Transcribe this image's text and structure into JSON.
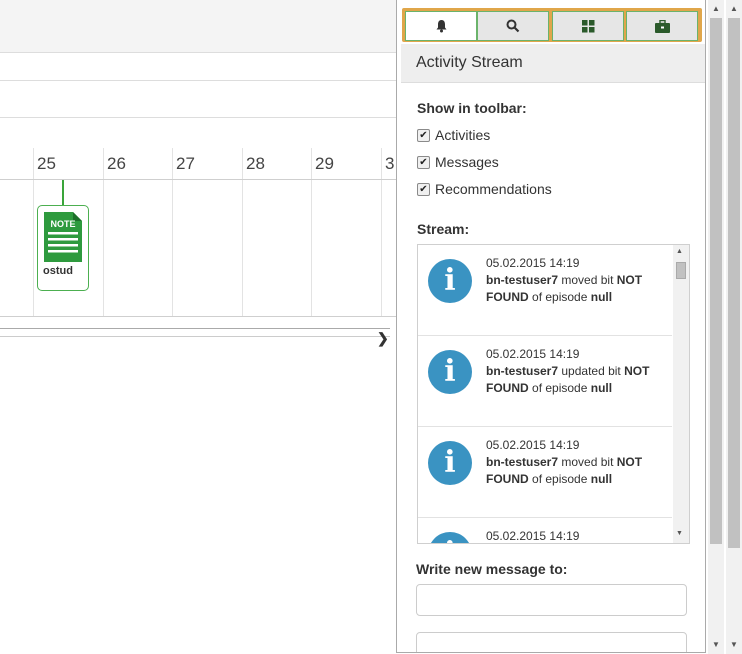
{
  "timeline": {
    "days": [
      "25",
      "26",
      "27",
      "28",
      "29",
      "3"
    ],
    "note": {
      "badge": "NOTE",
      "label": "ostud"
    }
  },
  "panel": {
    "tabs": [
      {
        "icon": "bell-icon",
        "active": true
      },
      {
        "icon": "search-icon",
        "active": false
      },
      {
        "icon": "grid-icon",
        "active": false
      },
      {
        "icon": "briefcase-icon",
        "active": false
      }
    ],
    "title": "Activity Stream",
    "toolbar_label": "Show in toolbar:",
    "checkboxes": [
      {
        "label": "Activities",
        "checked": true
      },
      {
        "label": "Messages",
        "checked": true
      },
      {
        "label": "Recommendations",
        "checked": true
      }
    ],
    "stream_label": "Stream:",
    "stream": [
      {
        "time": "05.02.2015 14:19",
        "user": "bn-testuser7",
        "action": "moved bit",
        "target": "NOT FOUND",
        "middle": "of episode",
        "episode": "null"
      },
      {
        "time": "05.02.2015 14:19",
        "user": "bn-testuser7",
        "action": "updated bit",
        "target": "NOT FOUND",
        "middle": "of episode",
        "episode": "null"
      },
      {
        "time": "05.02.2015 14:19",
        "user": "bn-testuser7",
        "action": "moved bit",
        "target": "NOT FOUND",
        "middle": "of episode",
        "episode": "null"
      },
      {
        "time": "05.02.2015 14:19"
      }
    ],
    "write_label": "Write new message to:",
    "recipient_value": "",
    "message_value": ""
  },
  "colors": {
    "tab_strip": "#e0a64a",
    "tab_border": "#6bb36b",
    "info_icon": "#3a93c2",
    "note_green": "#2e9a3e"
  }
}
